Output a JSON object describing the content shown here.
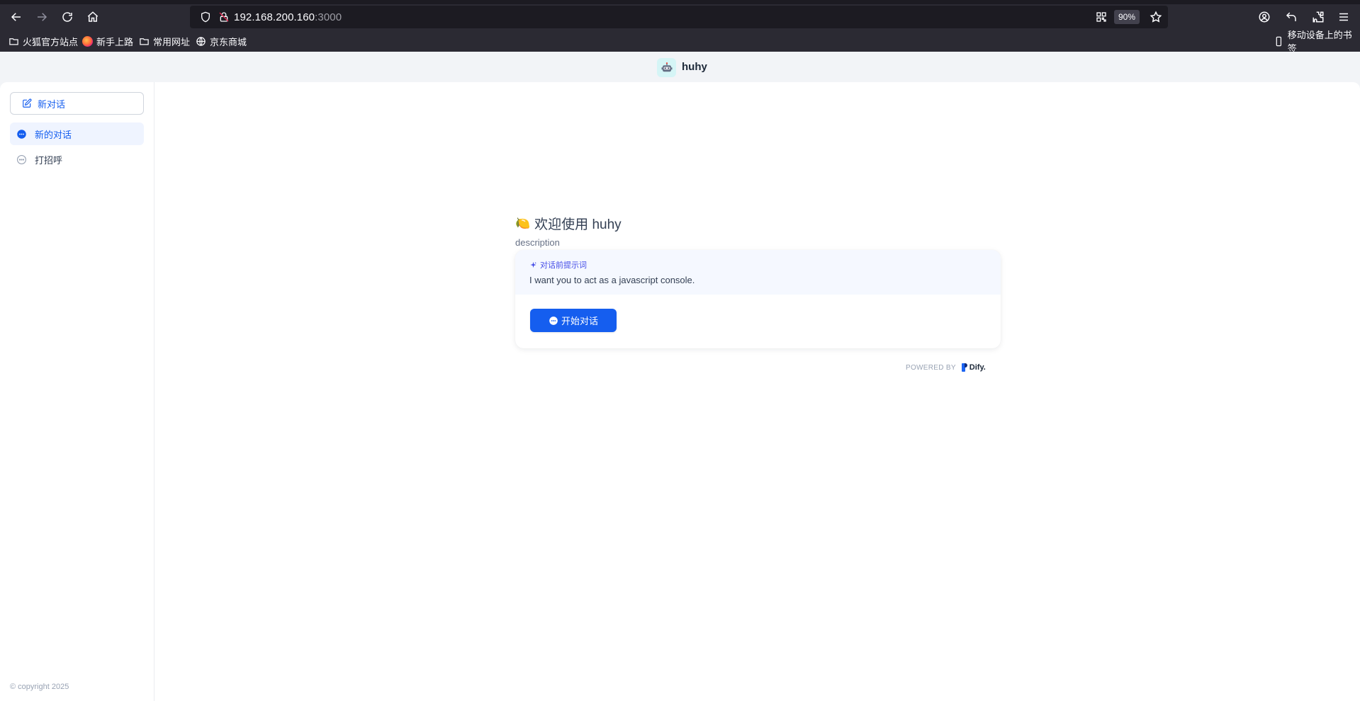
{
  "browser": {
    "url_host": "192.168.200.160",
    "url_port": ":3000",
    "zoom": "90%",
    "bookmarks": [
      {
        "label": "火狐官方站点",
        "icon": "folder-icon"
      },
      {
        "label": "新手上路",
        "icon": "firefox-icon"
      },
      {
        "label": "常用网址",
        "icon": "folder-icon"
      },
      {
        "label": "京东商城",
        "icon": "globe-icon"
      }
    ],
    "mobile_bookmarks": "移动设备上的书签"
  },
  "app": {
    "name": "huhy",
    "logo_icon": "robot-icon",
    "logo_bg": "#d5f5f6"
  },
  "sidebar": {
    "new_chat_label": "新对话",
    "conversations": [
      {
        "label": "新的对话",
        "active": true
      },
      {
        "label": "打招呼",
        "active": false
      }
    ],
    "copyright": "© copyright 2025"
  },
  "welcome": {
    "emoji": "🍋",
    "title": "欢迎使用 huhy",
    "description": "description",
    "prompt_label": "对话前提示词",
    "prompt_text": "I want you to act as a javascript console.",
    "start_button": "开始对话"
  },
  "footer": {
    "powered_by": "POWERED BY",
    "brand": "Dify."
  },
  "colors": {
    "accent": "#155eef",
    "prompt_accent": "#444ce7",
    "chrome_bg": "#2b2a33"
  }
}
